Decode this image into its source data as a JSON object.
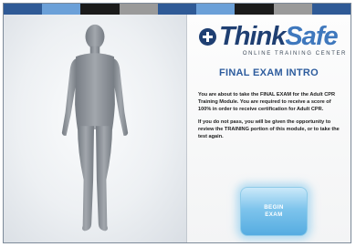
{
  "header": {
    "stripe_colors": [
      "#2f5a96",
      "#6ba0d8",
      "#1b1b1b",
      "#9a9a9a",
      "#2f5a96",
      "#6ba0d8",
      "#1b1b1b",
      "#9a9a9a",
      "#2f5a96"
    ]
  },
  "logo": {
    "icon": "plus-circle-icon",
    "think": "Think",
    "safe": "Safe",
    "tagline": "ONLINE TRAINING CENTER"
  },
  "exam": {
    "title": "FINAL EXAM INTRO",
    "paragraph_1": "You are about to take the FINAL EXAM for the Adult CPR Training Module. You are required to receive a score of 100% in order to receive certification for Adult CPR.",
    "paragraph_2": "If you do not pass, you will be given the opportunity to review the TRAINING portion of this module, or to take the test again.",
    "begin_button_label": "BEGIN EXAM"
  },
  "colors": {
    "brand_dark": "#1f3f72",
    "brand_light": "#3f78bd",
    "title": "#2d5c9e",
    "figure": "#8a9097",
    "button": "#7ec4ec"
  }
}
